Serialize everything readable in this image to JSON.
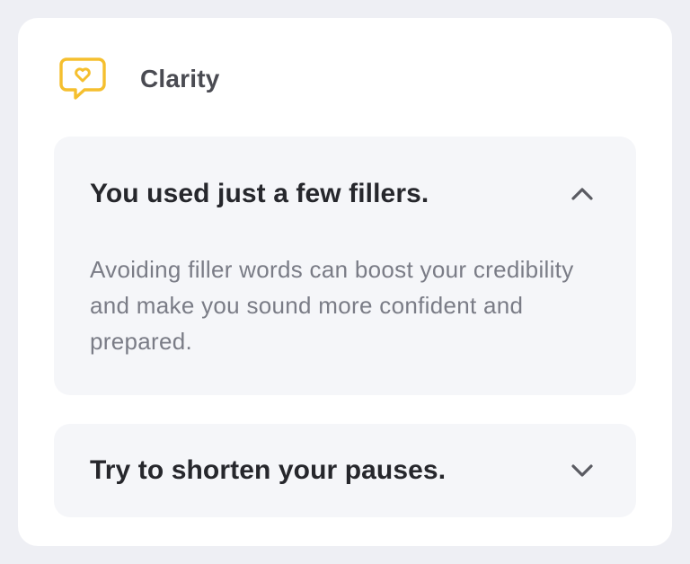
{
  "section": {
    "title": "Clarity",
    "icon": "speech-bubble-heart-icon",
    "accent_color": "#f5bf2e"
  },
  "items": [
    {
      "heading": "You used just a few fillers.",
      "body": "Avoiding filler words can boost your credibility and make you sound more confident and prepared.",
      "expanded": true,
      "toggle_icon": "chevron-up-icon"
    },
    {
      "heading": "Try to shorten your pauses.",
      "expanded": false,
      "toggle_icon": "chevron-down-icon"
    }
  ]
}
